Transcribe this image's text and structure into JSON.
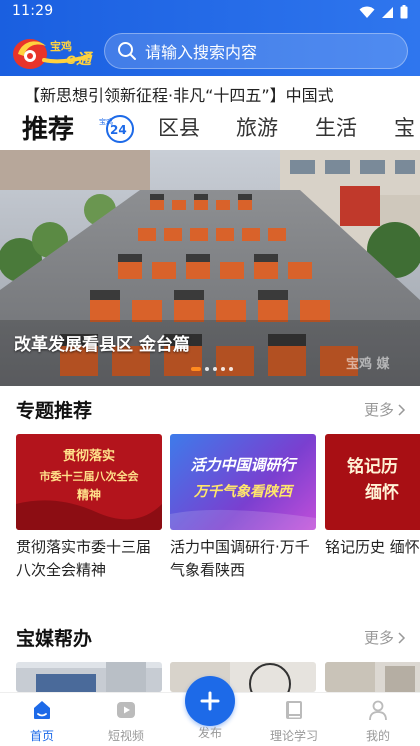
{
  "status": {
    "time": "11:29"
  },
  "header": {
    "logo_text": "宝鸡 一e通",
    "search_placeholder": "请输入搜索内容"
  },
  "ticker": {
    "text": "【新思想引领新征程·非凡“十四五”】中国式"
  },
  "tabs": [
    {
      "label": "推荐",
      "active": true
    },
    {
      "label": "区县"
    },
    {
      "label": "旅游"
    },
    {
      "label": "生活"
    },
    {
      "label": "宝"
    }
  ],
  "tab_badge": {
    "label": "宝鸡24"
  },
  "hero": {
    "caption": "改革发展看县区 金台篇",
    "watermark": "宝鸡 媒",
    "dots": 5,
    "active_dot": 1
  },
  "special": {
    "title": "专题推荐",
    "more": "更多",
    "cards": [
      {
        "image_text": "贯彻落实\n市委十三届八次全会\n精神",
        "title": "贯彻落实市委十三届八次全会精神",
        "bg": "#b3141c"
      },
      {
        "image_text": "活力中国调研行\n万千气象看陕西",
        "title": "活力中国调研行·万千气象看陕西",
        "bg": "#6a3fc8"
      },
      {
        "image_text": "铭记历\n缅怀",
        "title": "铭记历史 缅怀",
        "bg": "#a80f14"
      }
    ]
  },
  "help": {
    "title": "宝媒帮办",
    "more": "更多"
  },
  "bottom_nav": {
    "items": [
      {
        "label": "首页",
        "icon": "home-icon",
        "active": true
      },
      {
        "label": "短视频",
        "icon": "video-icon"
      },
      {
        "label": "发布",
        "icon": "plus-icon"
      },
      {
        "label": "理论学习",
        "icon": "book-icon"
      },
      {
        "label": "我的",
        "icon": "user-icon"
      }
    ]
  },
  "colors": {
    "brand": "#1d6ae8",
    "header": "#2a6ee8",
    "accent": "#ff8a1f"
  }
}
